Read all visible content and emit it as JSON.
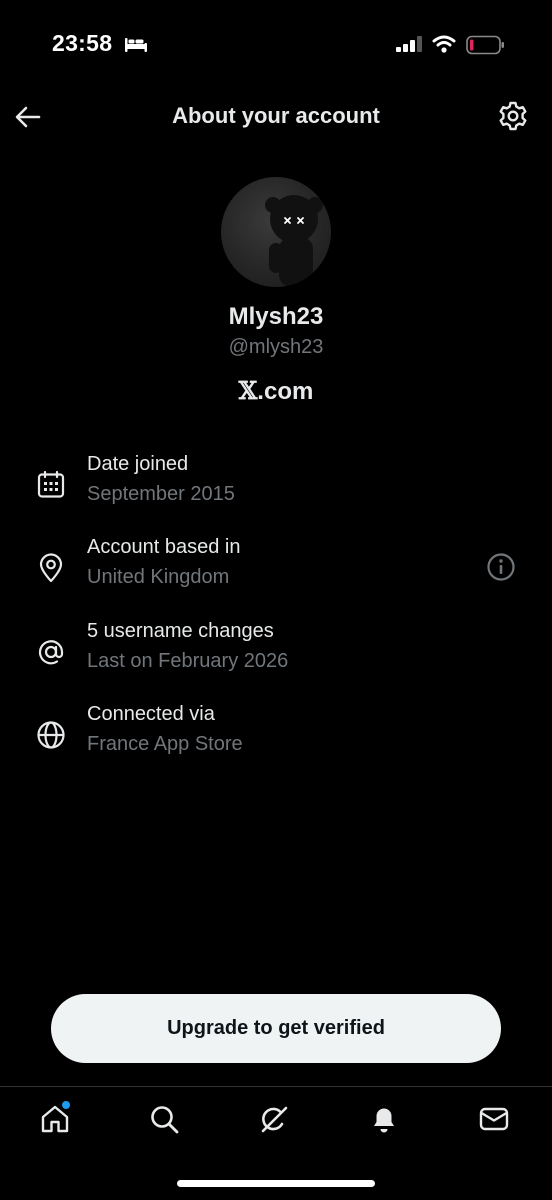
{
  "status_bar": {
    "time": "23:58",
    "icons": [
      "bed-icon",
      "signal-icon",
      "wifi-icon",
      "battery-icon"
    ],
    "battery_color": "#e0245e"
  },
  "header": {
    "title": "About your account",
    "back_icon": "back-arrow-icon",
    "settings_icon": "gear-icon"
  },
  "profile": {
    "display_name": "Mlysh23",
    "handle": "@mlysh23",
    "platform_mark": "𝕏",
    "platform_suffix": ".com"
  },
  "info": [
    {
      "icon": "calendar-icon",
      "title": "Date joined",
      "subtitle": "September 2015"
    },
    {
      "icon": "location-pin-icon",
      "title": "Account based in",
      "subtitle": "United Kingdom",
      "extra_icon": "info-icon"
    },
    {
      "icon": "at-sign-icon",
      "title": "5 username changes",
      "subtitle": "Last on February 2026"
    },
    {
      "icon": "globe-icon",
      "title": "Connected via",
      "subtitle": "France App Store"
    }
  ],
  "upgrade": {
    "label": "Upgrade to get verified"
  },
  "nav": {
    "items": [
      "home-icon",
      "search-icon",
      "grok-icon",
      "bell-icon",
      "mail-icon"
    ],
    "home_has_notification": true
  },
  "colors": {
    "background": "#000000",
    "text_primary": "#e7e9ea",
    "text_secondary": "#71767b",
    "accent": "#1d9bf0",
    "button_bg": "#eff3f4"
  }
}
